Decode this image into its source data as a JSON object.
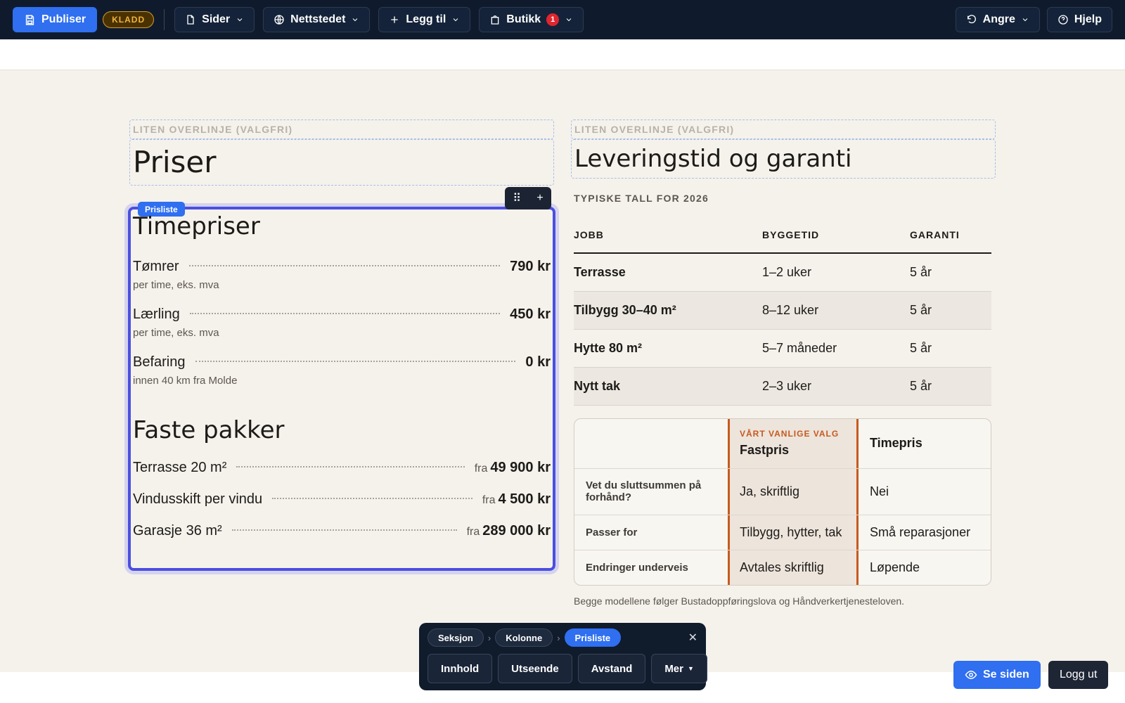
{
  "toolbar": {
    "publish_label": "Publiser",
    "draft_label": "KLADD",
    "pages_label": "Sider",
    "site_label": "Nettstedet",
    "add_label": "Legg til",
    "shop_label": "Butikk",
    "shop_badge": "1",
    "undo_label": "Angre",
    "help_label": "Hjelp"
  },
  "left": {
    "eyebrow": "LITEN OVERLINJE (VALGFRI)",
    "heading": "Priser",
    "block_tag": "Prisliste",
    "title1": "Timepriser",
    "items": [
      {
        "name": "Tømrer",
        "price": "790 kr",
        "sub": "per time, eks. mva"
      },
      {
        "name": "Lærling",
        "price": "450 kr",
        "sub": "per time, eks. mva"
      },
      {
        "name": "Befaring",
        "price": "0 kr",
        "sub": "innen 40 km fra Molde"
      }
    ],
    "title2": "Faste pakker",
    "packages": [
      {
        "name": "Terrasse 20 m²",
        "fra": "fra",
        "price": "49 900 kr"
      },
      {
        "name": "Vindusskift per vindu",
        "fra": "fra",
        "price": "4 500 kr"
      },
      {
        "name": "Garasje 36 m²",
        "fra": "fra",
        "price": "289 000 kr"
      }
    ]
  },
  "right": {
    "eyebrow": "LITEN OVERLINJE (VALGFRI)",
    "heading": "Leveringstid og garanti",
    "typical": "TYPISKE TALL FOR 2026",
    "columns": [
      "JOBB",
      "BYGGETID",
      "GARANTI"
    ],
    "rows": [
      [
        "Terrasse",
        "1–2 uker",
        "5 år"
      ],
      [
        "Tilbygg 30–40 m²",
        "8–12 uker",
        "5 år"
      ],
      [
        "Hytte 80 m²",
        "5–7 måneder",
        "5 år"
      ],
      [
        "Nytt tak",
        "2–3 uker",
        "5 år"
      ]
    ],
    "compare": {
      "highlight_tag": "VÅRT VANLIGE VALG",
      "col_fixed": "Fastpris",
      "col_hourly": "Timepris",
      "rows": [
        [
          "Vet du sluttsummen på forhånd?",
          "Ja, skriftlig",
          "Nei"
        ],
        [
          "Passer for",
          "Tilbygg, hytter, tak",
          "Små reparasjoner"
        ],
        [
          "Endringer underveis",
          "Avtales skriftlig",
          "Løpende"
        ]
      ]
    },
    "footnote": "Begge modellene følger Bustadoppføringslova og Håndverkertjenesteloven."
  },
  "editor": {
    "crumbs": [
      "Seksjon",
      "Kolonne",
      "Prisliste"
    ],
    "tabs": [
      "Innhold",
      "Utseende",
      "Avstand",
      "Mer"
    ],
    "view_label": "Se siden",
    "logout_label": "Logg ut"
  },
  "colors": {
    "toolbar_bg": "#0f1b2d",
    "accent": "#2f6ff0",
    "selection": "#4a4fe0",
    "highlight": "#c65a1e",
    "page_bg": "#f5f2ec"
  }
}
